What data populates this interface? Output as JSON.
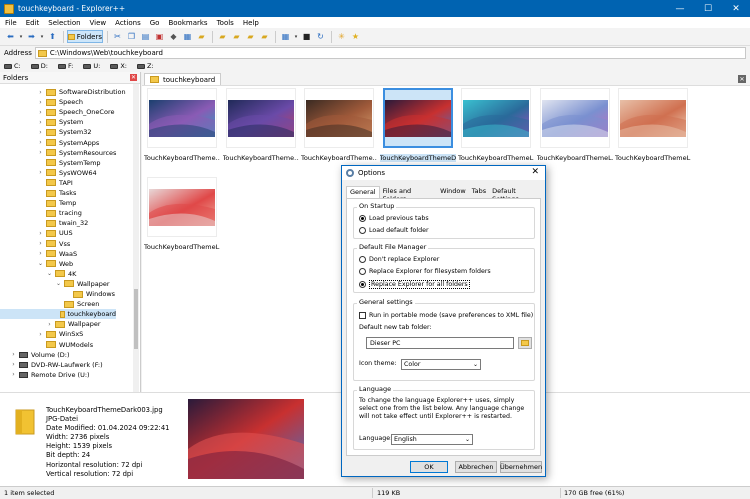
{
  "window": {
    "title": "touchkeyboard - Explorer++",
    "controls": [
      "—",
      "☐",
      "✕"
    ]
  },
  "menu": [
    "File",
    "Edit",
    "Selection",
    "View",
    "Actions",
    "Go",
    "Bookmarks",
    "Tools",
    "Help"
  ],
  "toolbar": {
    "folders_label": "Folders"
  },
  "address": {
    "label": "Address",
    "value": "C:\\Windows\\Web\\touchkeyboard"
  },
  "drives": [
    "C:",
    "D:",
    "F:",
    "U:",
    "X:",
    "Z:"
  ],
  "folders_panel": {
    "title": "Folders",
    "tree": [
      {
        "label": "SoftwareDistribution",
        "exp": ">"
      },
      {
        "label": "Speech",
        "exp": ">"
      },
      {
        "label": "Speech_OneCore",
        "exp": ">"
      },
      {
        "label": "System",
        "exp": ">"
      },
      {
        "label": "System32",
        "exp": ">"
      },
      {
        "label": "SystemApps",
        "exp": ">"
      },
      {
        "label": "SystemResources",
        "exp": ">"
      },
      {
        "label": "SystemTemp",
        "exp": ""
      },
      {
        "label": "SysWOW64",
        "exp": ">"
      },
      {
        "label": "TAPI",
        "exp": ""
      },
      {
        "label": "Tasks",
        "exp": ""
      },
      {
        "label": "Temp",
        "exp": ""
      },
      {
        "label": "tracing",
        "exp": ""
      },
      {
        "label": "twain_32",
        "exp": ""
      },
      {
        "label": "UUS",
        "exp": ">"
      },
      {
        "label": "Vss",
        "exp": ">"
      },
      {
        "label": "WaaS",
        "exp": ">"
      },
      {
        "label": "Web",
        "exp": "v"
      },
      {
        "label": "4K",
        "exp": "v"
      },
      {
        "label": "Wallpaper",
        "exp": "v"
      },
      {
        "label": "Windows",
        "exp": ""
      },
      {
        "label": "Screen",
        "exp": ""
      },
      {
        "label": "touchkeyboard",
        "exp": ""
      },
      {
        "label": "Wallpaper",
        "exp": ">"
      },
      {
        "label": "WinSxS",
        "exp": ">"
      },
      {
        "label": "WUModels",
        "exp": ""
      },
      {
        "label": "Volume (D:)",
        "exp": ">"
      },
      {
        "label": "DVD-RW-Laufwerk (F:)",
        "exp": ">"
      },
      {
        "label": "Remote Drive (U:)",
        "exp": ">"
      }
    ]
  },
  "tab": {
    "label": "touchkeyboard"
  },
  "files": [
    {
      "name": "TouchKeyboardTheme...",
      "c1": "#1b3f6e",
      "c2": "#8a5bb5",
      "c3": "#2aa0c0"
    },
    {
      "name": "TouchKeyboardTheme...",
      "c1": "#202a58",
      "c2": "#6a4aa8",
      "c3": "#c04060"
    },
    {
      "name": "TouchKeyboardTheme...",
      "c1": "#3a2a22",
      "c2": "#a05a3a",
      "c3": "#d8a070"
    },
    {
      "name": "TouchKeyboardThemeDa",
      "c1": "#2a1a3a",
      "c2": "#c83030",
      "c3": "#4a70c0"
    },
    {
      "name": "TouchKeyboardThemeL...",
      "c1": "#3ac0d0",
      "c2": "#2a6a9a",
      "c3": "#a050c0"
    },
    {
      "name": "TouchKeyboardThemeL...",
      "c1": "#e0e4f0",
      "c2": "#7a90d0",
      "c3": "#c070c0"
    },
    {
      "name": "TouchKeyboardThemeL...",
      "c1": "#e8c0a8",
      "c2": "#d07050",
      "c3": "#f0d8c0"
    },
    {
      "name": "TouchKeyboardThemeL...",
      "c1": "#e8d8d8",
      "c2": "#e04848",
      "c3": "#f0b0a0"
    }
  ],
  "info": {
    "lines": [
      "TouchKeyboardThemeDark003.jpg",
      "JPG-Datei",
      "Date Modified: 01.04.2024 09:22:41",
      "Width: 2736 pixels",
      "Height: 1539 pixels",
      "Bit depth: 24",
      "Horizontal resolution: 72 dpi",
      "Vertical resolution: 72 dpi"
    ]
  },
  "status": {
    "selection": "1 item selected",
    "size": "119 KB",
    "free": "170 GB free (61%)"
  },
  "dialog": {
    "title": "Options",
    "tabs": [
      "General",
      "Files and Folders",
      "Window",
      "Tabs",
      "Default Settings"
    ],
    "on_startup": {
      "label": "On Startup",
      "options": [
        "Load previous tabs",
        "Load default folder"
      ]
    },
    "default_manager": {
      "label": "Default File Manager",
      "options": [
        "Don't replace Explorer",
        "Replace Explorer for filesystem folders",
        "Replace Explorer for all folders"
      ]
    },
    "general": {
      "label": "General settings",
      "portable": "Run in portable mode (save preferences to XML file)",
      "new_tab_label": "Default new tab folder:",
      "new_tab_value": "Dieser PC",
      "icon_theme_label": "Icon theme:",
      "icon_theme_value": "Color"
    },
    "language": {
      "label": "Language",
      "description": "To change the language Explorer++ uses, simply select one from the list below. Any language change will not take effect until Explorer++ is restarted.",
      "field_label": "Language:",
      "value": "English"
    },
    "buttons": {
      "ok": "OK",
      "cancel": "Abbrechen",
      "apply": "Übernehmen"
    }
  }
}
